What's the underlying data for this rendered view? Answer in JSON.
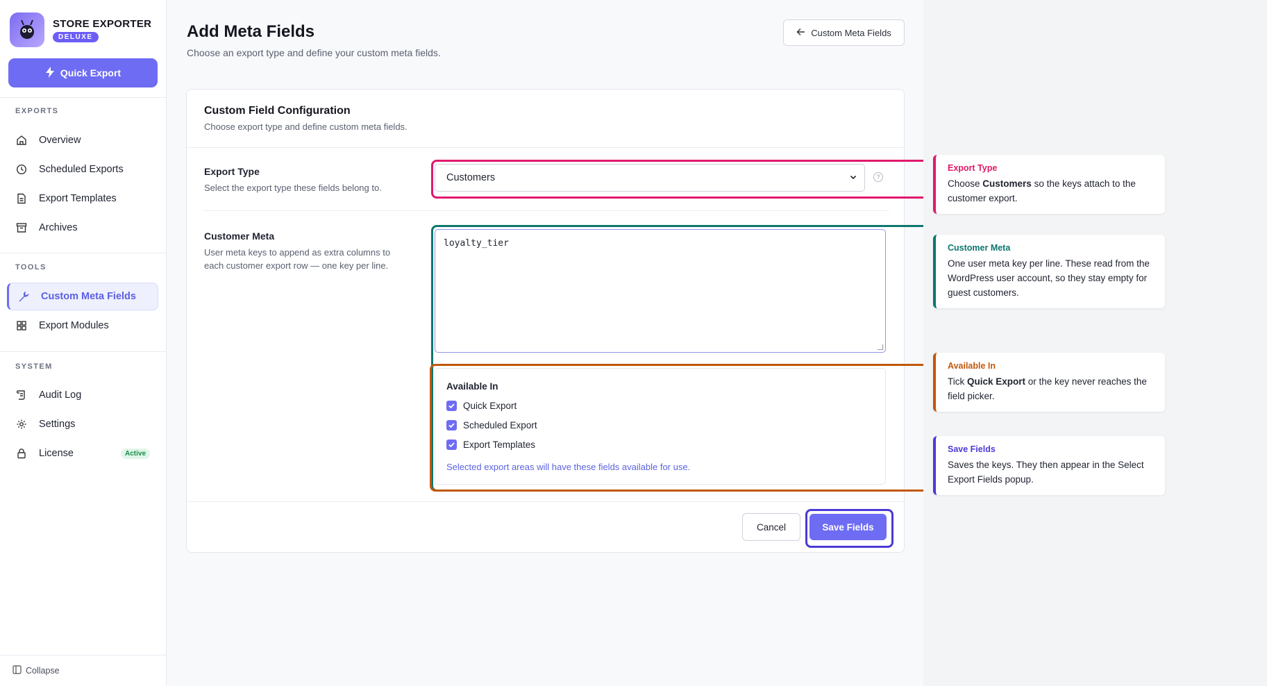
{
  "brand": {
    "name": "STORE EXPORTER",
    "badge": "DELUXE"
  },
  "sidebar": {
    "quick_export_label": "Quick Export",
    "sections": {
      "exports": "EXPORTS",
      "tools": "TOOLS",
      "system": "SYSTEM"
    },
    "items": {
      "overview": "Overview",
      "scheduled_exports": "Scheduled Exports",
      "export_templates": "Export Templates",
      "archives": "Archives",
      "custom_meta_fields": "Custom Meta Fields",
      "export_modules": "Export Modules",
      "audit_log": "Audit Log",
      "settings": "Settings",
      "license": "License"
    },
    "license_badge": "Active",
    "collapse_label": "Collapse"
  },
  "header": {
    "title": "Add Meta Fields",
    "subtitle": "Choose an export type and define your custom meta fields.",
    "back_button": "Custom Meta Fields"
  },
  "card": {
    "title": "Custom Field Configuration",
    "subtitle": "Choose export type and define custom meta fields.",
    "export_type": {
      "label": "Export Type",
      "help": "Select the export type these fields belong to.",
      "selected": "Customers"
    },
    "customer_meta": {
      "label": "Customer Meta",
      "help": "User meta keys to append as extra columns to each customer export row — one key per line.",
      "value": "loyalty_tier"
    },
    "available_in": {
      "title": "Available In",
      "options": [
        "Quick Export",
        "Scheduled Export",
        "Export Templates"
      ],
      "checked": [
        true,
        true,
        true
      ],
      "note": "Selected export areas will have these fields available for use."
    },
    "cancel_label": "Cancel",
    "save_label": "Save Fields"
  },
  "annotations": [
    {
      "title": "Export Type",
      "color": "#e0186c",
      "body_pre": "Choose ",
      "body_bold": "Customers",
      "body_post": " so the keys attach to the customer export."
    },
    {
      "title": "Customer Meta",
      "color": "#0f766e",
      "body_pre": "One user meta key per line. These read from the WordPress user account, so they stay empty for guest customers.",
      "body_bold": "",
      "body_post": ""
    },
    {
      "title": "Available In",
      "color": "#c2570c",
      "body_pre": "Tick ",
      "body_bold": "Quick Export",
      "body_post": " or the key never reaches the field picker."
    },
    {
      "title": "Save Fields",
      "color": "#4a3ad6",
      "body_pre": "Saves the keys. They then appear in the Select Export Fields popup.",
      "body_bold": "",
      "body_post": ""
    }
  ]
}
